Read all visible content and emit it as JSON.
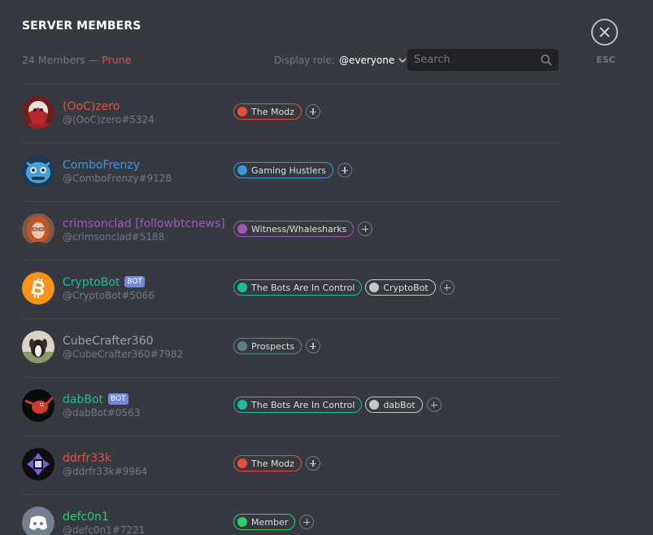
{
  "header": {
    "title": "SERVER MEMBERS",
    "member_count": "24 Members",
    "separator": "—",
    "prune_label": "Prune",
    "display_role_label": "Display role:",
    "display_role_value": "@everyone",
    "search_placeholder": "Search",
    "close_label": "ESC"
  },
  "colors": {
    "background": "#36393f",
    "prune": "#f04747",
    "bot_badge": "#7289da"
  },
  "members": [
    {
      "name": "(OoC)zero",
      "tag": "@(OoC)zero#5324",
      "name_color": "#e74c3c",
      "bot": false,
      "avatar": "red-white-character-avatar",
      "roles": [
        {
          "label": "The Modz",
          "color": "#e74c3c"
        }
      ]
    },
    {
      "name": "ComboFrenzy",
      "tag": "@ComboFrenzy#9128",
      "name_color": "#3498db",
      "bot": false,
      "avatar": "blue-robot-avatar",
      "roles": [
        {
          "label": "Gaming Hustlers",
          "color": "#3498db"
        }
      ]
    },
    {
      "name": "crimsonclad [followbtcnews]",
      "tag": "@crimsonclad#5188",
      "name_color": "#9b59b6",
      "bot": false,
      "avatar": "woman-photo-avatar",
      "roles": [
        {
          "label": "Witness/Whalesharks",
          "color": "#9b59b6"
        }
      ]
    },
    {
      "name": "CryptoBot",
      "tag": "@CryptoBot#5066",
      "name_color": "#1abc9c",
      "bot": true,
      "bot_label": "BOT",
      "avatar": "bitcoin-icon",
      "roles": [
        {
          "label": "The Bots Are In Control",
          "color": "#1abc9c"
        },
        {
          "label": "CryptoBot",
          "color": "#c6c6c6"
        }
      ]
    },
    {
      "name": "CubeCrafter360",
      "tag": "@CubeCrafter360#7982",
      "name_color": "#95a5a6",
      "bot": false,
      "avatar": "dog-photo-avatar",
      "roles": [
        {
          "label": "Prospects",
          "color": "#607d8b"
        }
      ]
    },
    {
      "name": "dabBot",
      "tag": "@dabBot#0563",
      "name_color": "#1abc9c",
      "bot": true,
      "bot_label": "BOT",
      "avatar": "dab-creature-avatar",
      "roles": [
        {
          "label": "The Bots Are In Control",
          "color": "#1abc9c"
        },
        {
          "label": "dabBot",
          "color": "#c6c6c6"
        }
      ]
    },
    {
      "name": "ddrfr33k",
      "tag": "@ddrfr33k#9964",
      "name_color": "#e74c3c",
      "bot": false,
      "avatar": "ddr-arrows-avatar",
      "roles": [
        {
          "label": "The Modz",
          "color": "#e74c3c"
        }
      ]
    },
    {
      "name": "defc0n1",
      "tag": "@defc0n1#7221",
      "name_color": "#2ecc71",
      "bot": false,
      "avatar": "discord-default-avatar",
      "roles": [
        {
          "label": "Member",
          "color": "#2ecc71"
        }
      ]
    }
  ]
}
